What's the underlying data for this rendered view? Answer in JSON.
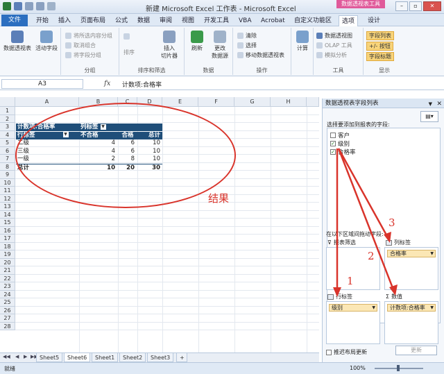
{
  "title_bar": {
    "title": "新建 Microsoft Excel 工作表 - Microsoft Excel",
    "context_tools": "数据透视表工具"
  },
  "ribbon_tabs": [
    "文件",
    "开始",
    "插入",
    "页面布局",
    "公式",
    "数据",
    "审阅",
    "视图",
    "开发工具",
    "VBA",
    "Acrobat",
    "自定义功能区",
    "选项",
    "设计"
  ],
  "active_tab": "选项",
  "ribbon": {
    "pivot_table_label": "数据透视表",
    "active_field_label": "活动字段",
    "expand_label": "将所选内容分组",
    "ungroup_label": "取消组合",
    "group_field_label": "将字段分组",
    "group_group": "分组",
    "sort_label": "排序",
    "insert_slicer_label": "插入\n切片器",
    "sort_filter_group": "排序和筛选",
    "refresh_label": "刷新",
    "change_source_label": "更改\n数据源",
    "data_group": "数据",
    "clear_label": "清除",
    "select_label": "选择",
    "move_label": "移动数据透视表",
    "actions_group": "操作",
    "calc_label": "计算",
    "pivot_chart_label": "数据透视图",
    "olap_label": "OLAP 工具",
    "whatif_label": "模拟分析",
    "tools_group": "工具",
    "field_list_label": "字段列表",
    "plusminus_label": "+/- 按钮",
    "field_headers_label": "字段标题",
    "show_group": "显示"
  },
  "formula_bar": {
    "name_box": "A3",
    "fx": "fx",
    "formula": "计数项:合格率"
  },
  "columns": [
    "A",
    "B",
    "C",
    "D",
    "E",
    "F",
    "G",
    "H"
  ],
  "rows": [
    "1",
    "2",
    "3",
    "4",
    "5",
    "6",
    "7",
    "8",
    "9",
    "10",
    "11",
    "12",
    "13",
    "14",
    "15",
    "16",
    "17",
    "18",
    "19",
    "20",
    "21",
    "22",
    "23",
    "24",
    "25",
    "26",
    "27",
    "28"
  ],
  "pivot": {
    "count_label": "计数项:合格率",
    "col_label": "列标签",
    "row_label": "行标签",
    "col_headers": [
      "不合格",
      "合格",
      "总计"
    ],
    "rows": [
      {
        "label": "二级",
        "values": [
          "4",
          "6",
          "10"
        ]
      },
      {
        "label": "三级",
        "values": [
          "4",
          "6",
          "10"
        ]
      },
      {
        "label": "一级",
        "values": [
          "2",
          "8",
          "10"
        ]
      }
    ],
    "total": {
      "label": "总计",
      "values": [
        "10",
        "20",
        "30"
      ]
    }
  },
  "annotation": {
    "result_label": "结果",
    "numbers": [
      "1",
      "2",
      "3"
    ]
  },
  "sheet_tabs": [
    "Sheet5",
    "Sheet6",
    "Sheet1",
    "Sheet2",
    "Sheet3"
  ],
  "active_sheet": "Sheet6",
  "status": {
    "ready": "就绪",
    "zoom": "100%"
  },
  "field_pane": {
    "title": "数据透视表字段列表",
    "choose_label": "选择要添加到报表的字段:",
    "fields": [
      {
        "name": "客户",
        "checked": false
      },
      {
        "name": "级别",
        "checked": true
      },
      {
        "name": "合格率",
        "checked": true
      }
    ],
    "drag_label": "在以下区域间拖动字段:",
    "report_filter": "报表筛选",
    "column_labels": "列标签",
    "row_labels": "行标签",
    "values": "数值",
    "column_item": "合格率",
    "row_item": "级别",
    "value_item": "计数项:合格率",
    "defer_label": "推迟布局更新",
    "update_label": "更新"
  },
  "colors": {
    "pivot_header": "#1f4e79",
    "annotation": "#d9342b",
    "file_tab": "#2c6fc0",
    "context_tab": "#e05a9a"
  }
}
